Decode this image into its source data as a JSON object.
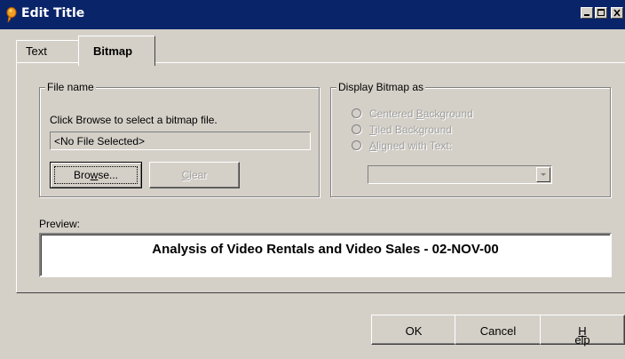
{
  "window": {
    "title": "Edit Title",
    "controls": [
      "minimize-icon",
      "maximize-icon",
      "close-icon"
    ]
  },
  "tabs": [
    {
      "label": "Text",
      "active": false
    },
    {
      "label": "Bitmap",
      "active": true
    }
  ],
  "file_group": {
    "legend": "File name",
    "instruction": "Click Browse to select a bitmap file.",
    "file_value": "<No File Selected>",
    "browse_pre": "Bro",
    "browse_mn": "w",
    "browse_post": "se...",
    "clear_mn": "C",
    "clear_post": "lear"
  },
  "display_group": {
    "legend": "Display Bitmap as",
    "options": [
      {
        "pre": "Centered ",
        "mn": "B",
        "post": "ackground"
      },
      {
        "pre": "",
        "mn": "T",
        "post": "iled Background"
      },
      {
        "pre": "",
        "mn": "A",
        "post": "ligned with Text:"
      }
    ],
    "align_value": ""
  },
  "preview": {
    "label": "Preview:",
    "text": "Analysis of Video Rentals and Video Sales  - 02-NOV-00"
  },
  "footer": {
    "ok": "OK",
    "cancel": "Cancel",
    "help_mn": "H",
    "help_post": "elp"
  },
  "colors": {
    "titlebar": "#0a246a",
    "face": "#d4d0c8"
  }
}
